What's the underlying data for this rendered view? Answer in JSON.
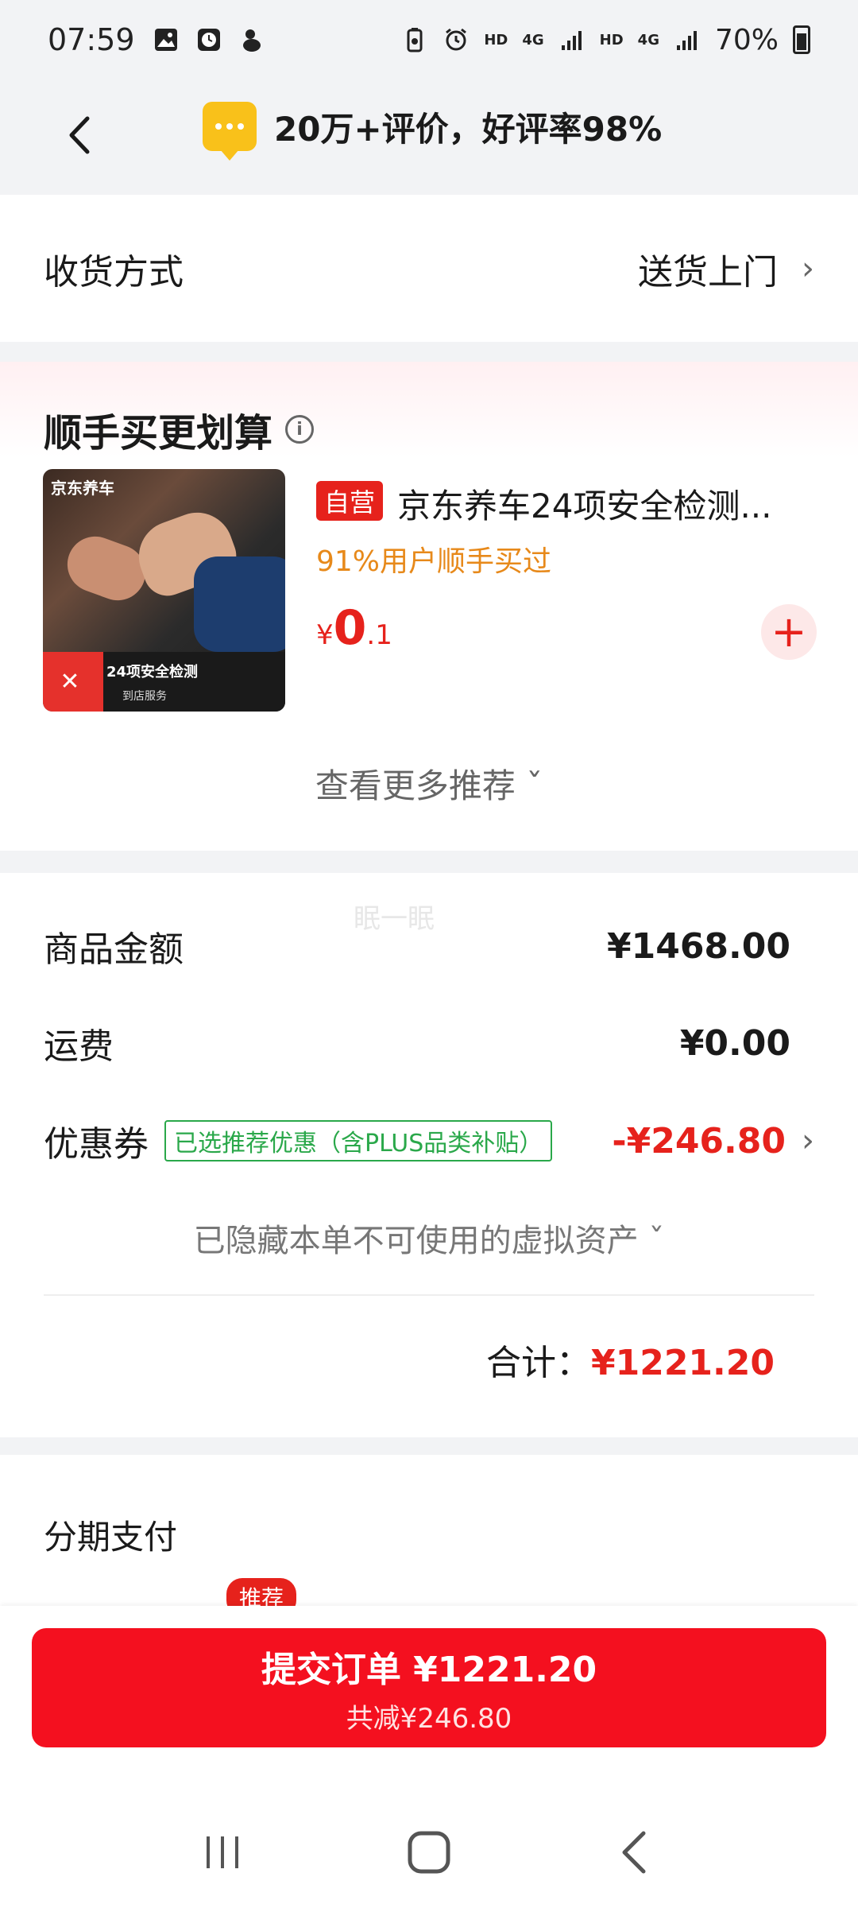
{
  "status_bar": {
    "time": "07:59",
    "network_labels": [
      "HD",
      "4G",
      "HD",
      "4G"
    ],
    "battery": "70%"
  },
  "header": {
    "title": "20万+评价，好评率98%"
  },
  "delivery": {
    "label": "收货方式",
    "value": "送货上门"
  },
  "recommend": {
    "title": "顺手买更划算",
    "product": {
      "image_brand": "京东养车",
      "image_banner": "24项安全检测",
      "image_banner_sub": "到店服务",
      "badge": "自营",
      "name": "京东养车24项安全检测...",
      "stat": "91%用户顺手买过",
      "price_currency": "¥",
      "price_int": "0",
      "price_dec": ".1"
    },
    "more_label": "查看更多推荐"
  },
  "amounts": {
    "watermark": "眠一眠",
    "goods_label": "商品金额",
    "goods_value": "¥1468.00",
    "shipping_label": "运费",
    "shipping_value": "¥0.00",
    "coupon_label": "优惠券",
    "coupon_tag": "已选推荐优惠（含PLUS品类补贴）",
    "coupon_value": "-¥246.80",
    "hidden_assets": "已隐藏本单不可使用的虚拟资产",
    "total_label": "合计：",
    "total_value": "¥1221.20"
  },
  "installment": {
    "title": "分期支付",
    "recommend_pill": "推荐"
  },
  "submit": {
    "main": "提交订单 ¥1221.20",
    "sub": "共减¥246.80"
  },
  "colors": {
    "accent_red": "#f4101f",
    "price_red": "#e6221c",
    "coupon_green": "#2aa84a",
    "stat_orange": "#e7891a",
    "chat_yellow": "#f9c11a"
  }
}
